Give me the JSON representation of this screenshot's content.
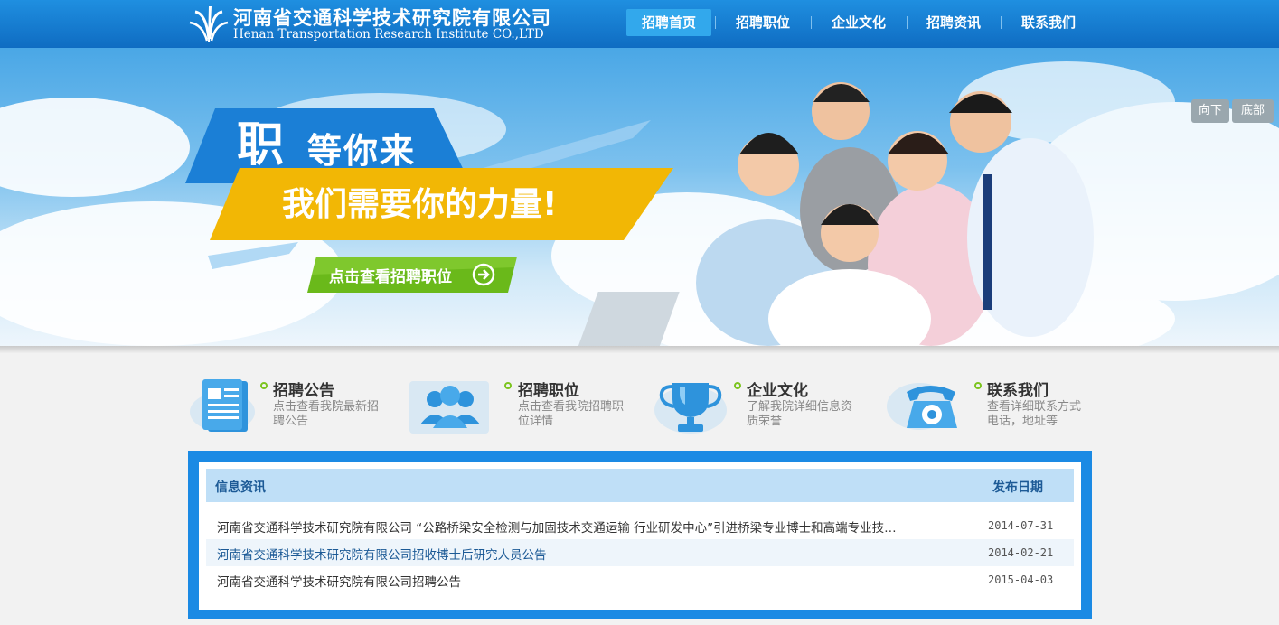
{
  "header": {
    "logo_cn": "河南省交通科学技术研究院有限公司",
    "logo_en": "Henan Transportation Research Institute CO.,LTD",
    "nav": [
      {
        "label": "招聘首页",
        "active": true
      },
      {
        "label": "招聘职位",
        "active": false
      },
      {
        "label": "企业文化",
        "active": false
      },
      {
        "label": "招聘资讯",
        "active": false
      },
      {
        "label": "联系我们",
        "active": false
      }
    ]
  },
  "banner": {
    "headline_big": "职",
    "headline_rest": "等你来",
    "slogan": "我们需要你的力量!",
    "cta_label": "点击查看招聘职位",
    "side_buttons": [
      "向下",
      "底部"
    ],
    "colors": {
      "accent": "#1b8ae4",
      "slogan_bg": "#f2b705",
      "cta_bg": "#6ab91a"
    }
  },
  "features": [
    {
      "title": "招聘公告",
      "desc": "点击查看我院最新招聘公告",
      "icon": "document-icon"
    },
    {
      "title": "招聘职位",
      "desc": "点击查看我院招聘职位详情",
      "icon": "people-icon"
    },
    {
      "title": "企业文化",
      "desc": "了解我院详细信息资质荣誉",
      "icon": "trophy-icon"
    },
    {
      "title": "联系我们",
      "desc": "查看详细联系方式电话，地址等",
      "icon": "phone-icon"
    }
  ],
  "news": {
    "header_left": "信息资讯",
    "header_right": "发布日期",
    "items": [
      {
        "title": "河南省交通科学技术研究院有限公司 “公路桥梁安全检测与加固技术交通运输 行业研发中心”引进桥梁专业博士和高端专业技…",
        "date": "2014-07-31"
      },
      {
        "title": "河南省交通科学技术研究院有限公司招收博士后研究人员公告",
        "date": "2014-02-21"
      },
      {
        "title": "河南省交通科学技术研究院有限公司招聘公告",
        "date": "2015-04-03"
      }
    ]
  }
}
